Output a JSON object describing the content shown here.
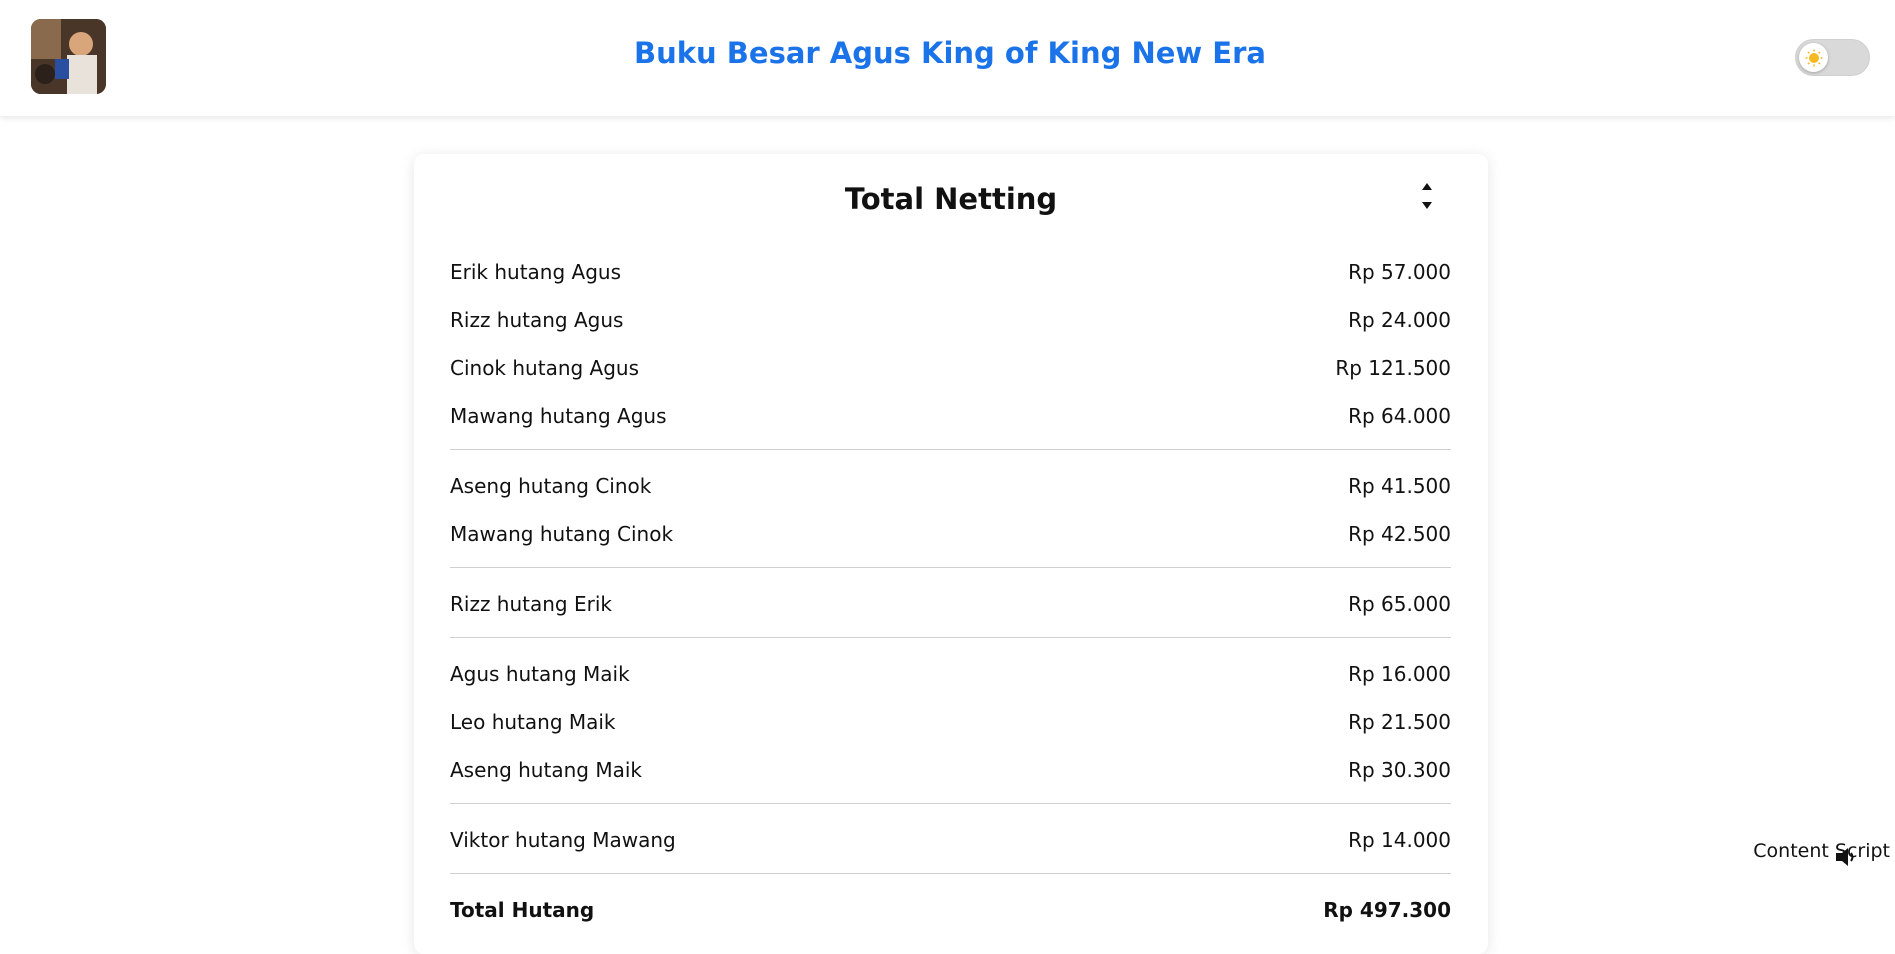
{
  "header": {
    "title": "Buku Besar Agus King of King New Era",
    "title_color": "#1a73e8",
    "theme_toggle": {
      "state": "light",
      "icon": "sun-icon"
    }
  },
  "card": {
    "title": "Total Netting",
    "sort_icon": "sort-updown-icon",
    "groups": [
      {
        "creditor": "Agus",
        "rows": [
          {
            "label": "Erik hutang Agus",
            "amount": "Rp 57.000"
          },
          {
            "label": "Rizz hutang Agus",
            "amount": "Rp 24.000"
          },
          {
            "label": "Cinok hutang Agus",
            "amount": "Rp 121.500"
          },
          {
            "label": "Mawang hutang Agus",
            "amount": "Rp 64.000"
          }
        ]
      },
      {
        "creditor": "Cinok",
        "rows": [
          {
            "label": "Aseng hutang Cinok",
            "amount": "Rp 41.500"
          },
          {
            "label": "Mawang hutang Cinok",
            "amount": "Rp 42.500"
          }
        ]
      },
      {
        "creditor": "Erik",
        "rows": [
          {
            "label": "Rizz hutang Erik",
            "amount": "Rp 65.000"
          }
        ]
      },
      {
        "creditor": "Maik",
        "rows": [
          {
            "label": "Agus hutang Maik",
            "amount": "Rp 16.000"
          },
          {
            "label": "Leo hutang Maik",
            "amount": "Rp 21.500"
          },
          {
            "label": "Aseng hutang Maik",
            "amount": "Rp 30.300"
          }
        ]
      },
      {
        "creditor": "Mawang",
        "rows": [
          {
            "label": "Viktor hutang Mawang",
            "amount": "Rp 14.000"
          }
        ]
      }
    ],
    "total": {
      "label": "Total Hutang",
      "amount": "Rp 497.300"
    }
  },
  "overlay": {
    "content_script_label": "Content Script",
    "icon": "speaker-icon"
  }
}
